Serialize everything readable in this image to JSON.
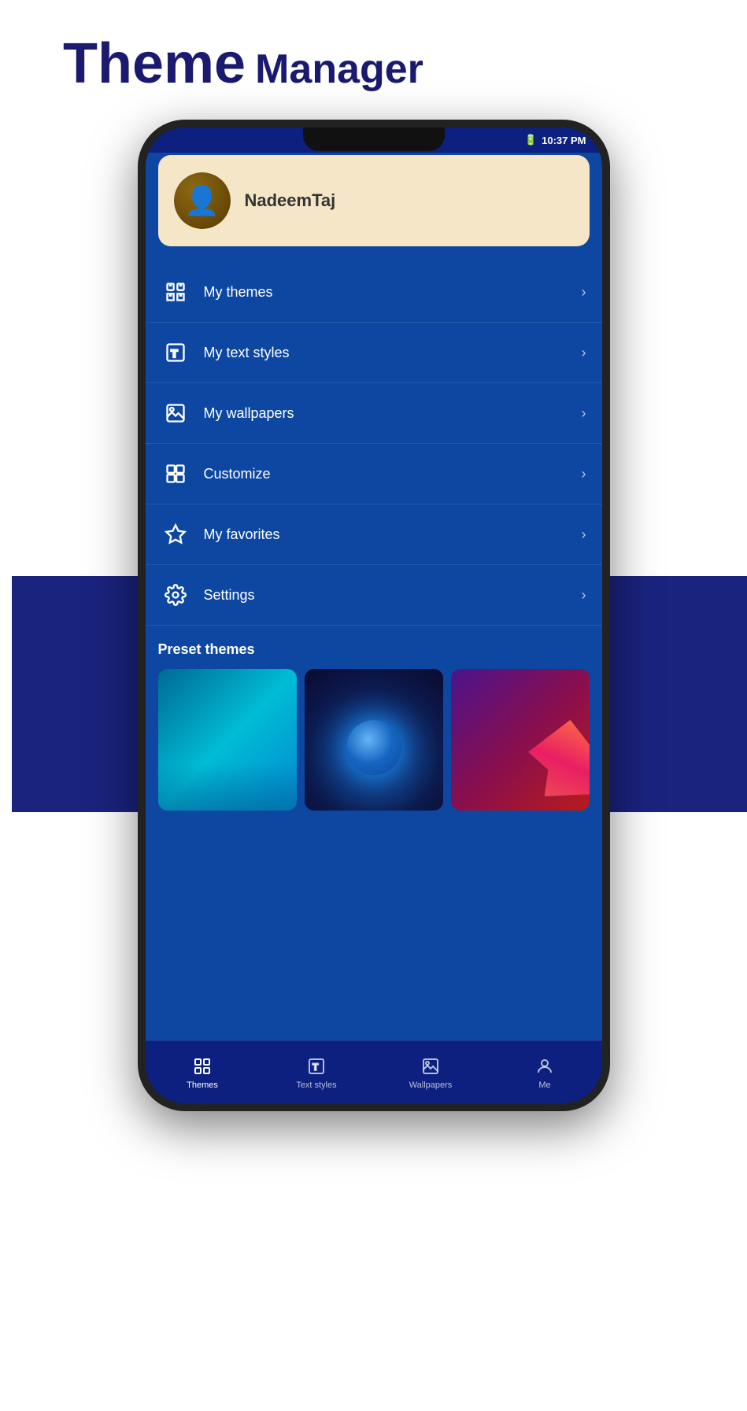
{
  "header": {
    "theme_bold": "Theme",
    "manager": "Manager"
  },
  "profile": {
    "username": "NadeemTaj"
  },
  "status_bar": {
    "time": "10:37 PM"
  },
  "menu": {
    "items": [
      {
        "id": "my-themes",
        "label": "My themes",
        "icon": "paint-brush"
      },
      {
        "id": "my-text-styles",
        "label": "My text styles",
        "icon": "text"
      },
      {
        "id": "my-wallpapers",
        "label": "My wallpapers",
        "icon": "image"
      },
      {
        "id": "customize",
        "label": "Customize",
        "icon": "grid"
      },
      {
        "id": "my-favorites",
        "label": "My favorites",
        "icon": "star"
      },
      {
        "id": "settings",
        "label": "Settings",
        "icon": "gear"
      }
    ]
  },
  "preset_themes": {
    "title": "Preset themes"
  },
  "bottom_nav": {
    "items": [
      {
        "id": "themes",
        "label": "Themes",
        "active": true
      },
      {
        "id": "text-styles",
        "label": "Text styles",
        "active": false
      },
      {
        "id": "wallpapers",
        "label": "Wallpapers",
        "active": false
      },
      {
        "id": "me",
        "label": "Me",
        "active": false
      }
    ]
  }
}
